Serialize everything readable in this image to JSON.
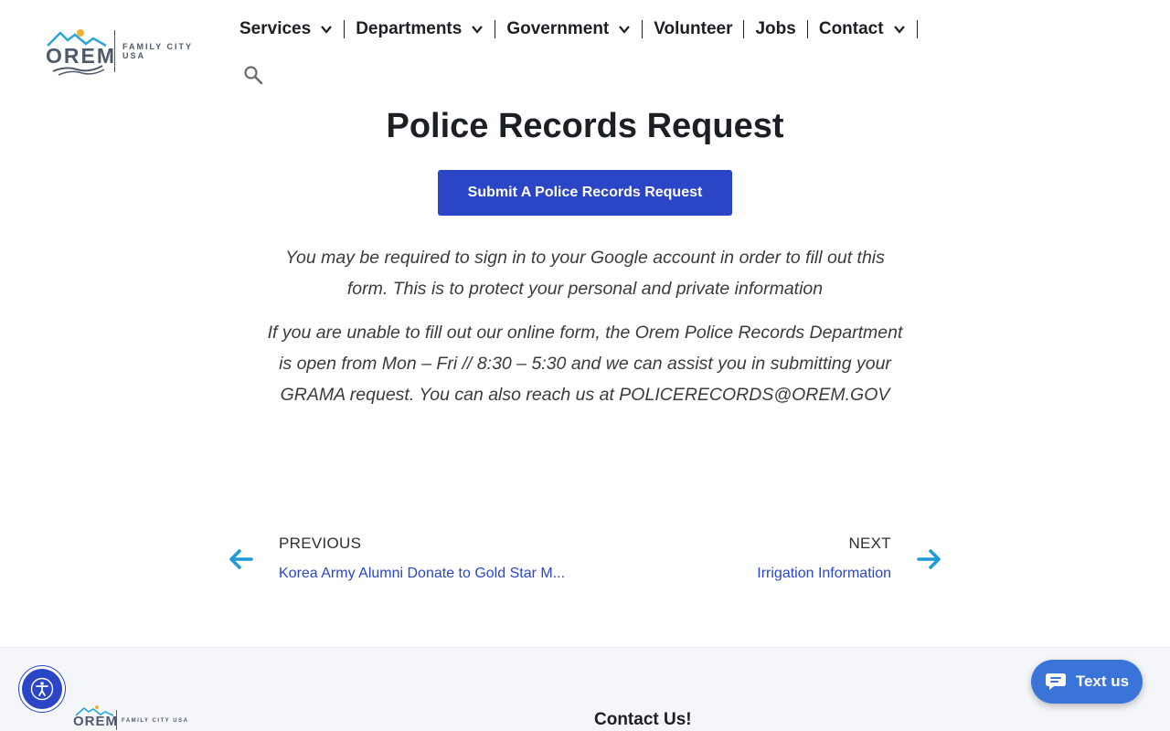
{
  "header": {
    "logo": {
      "word": "OREM",
      "tagline": "FAMILY CITY USA"
    },
    "nav": [
      {
        "label": "Services",
        "has_dropdown": true
      },
      {
        "label": "Departments",
        "has_dropdown": true
      },
      {
        "label": "Government",
        "has_dropdown": true
      },
      {
        "label": "Volunteer",
        "has_dropdown": false
      },
      {
        "label": "Jobs",
        "has_dropdown": false
      },
      {
        "label": "Contact",
        "has_dropdown": true
      }
    ],
    "search_icon": "search-icon"
  },
  "main": {
    "title": "Police Records Request",
    "cta_label": "Submit A Police Records Request",
    "paragraph_1": "You may be required to sign in to your Google account in order to fill out this form. This is to protect your personal and private information",
    "paragraph_2": "If you are unable to fill out our online form, the Orem Police Records Department is open from Mon – Fri // 8:30 – 5:30 and we can assist you in submitting your GRAMA request. You can also reach us at POLICERECORDS@OREM.GOV"
  },
  "post_nav": {
    "previous": {
      "label": "PREVIOUS",
      "title": "Korea Army Alumni Donate to Gold Star M..."
    },
    "next": {
      "label": "NEXT",
      "title": "Irrigation Information"
    }
  },
  "footer": {
    "logo": {
      "word": "OREM",
      "tagline": "FAMILY CITY USA"
    },
    "contact_heading": "Contact Us!"
  },
  "widgets": {
    "text_us_label": "Text us",
    "accessibility_icon": "accessibility-icon"
  },
  "colors": {
    "brand_blue": "#2a46c7",
    "link_blue": "#2a46c7",
    "arrow_blue": "#1e9ad6",
    "text_us_blue": "#3b74d8",
    "logo_gray": "#4e5a6b"
  }
}
